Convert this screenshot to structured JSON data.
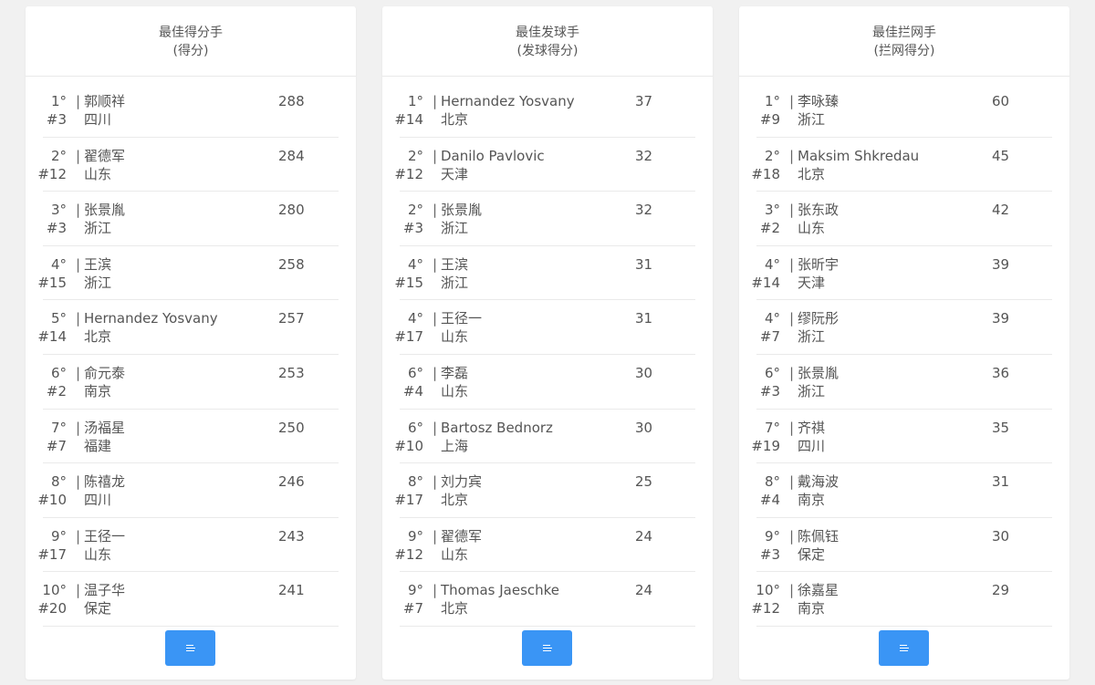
{
  "boards": [
    {
      "title": "最佳得分手",
      "subtitle": "(得分)",
      "button_icon": "list-icon",
      "rows": [
        {
          "rank": "1°",
          "num": "#3",
          "name": "郭顺祥",
          "team": "四川",
          "score": "288"
        },
        {
          "rank": "2°",
          "num": "#12",
          "name": "翟德军",
          "team": "山东",
          "score": "284"
        },
        {
          "rank": "3°",
          "num": "#3",
          "name": "张景胤",
          "team": "浙江",
          "score": "280"
        },
        {
          "rank": "4°",
          "num": "#15",
          "name": "王滨",
          "team": "浙江",
          "score": "258"
        },
        {
          "rank": "5°",
          "num": "#14",
          "name": "Hernandez Yosvany",
          "team": "北京",
          "score": "257"
        },
        {
          "rank": "6°",
          "num": "#2",
          "name": "俞元泰",
          "team": "南京",
          "score": "253"
        },
        {
          "rank": "7°",
          "num": "#7",
          "name": "汤福星",
          "team": "福建",
          "score": "250"
        },
        {
          "rank": "8°",
          "num": "#10",
          "name": "陈禧龙",
          "team": "四川",
          "score": "246"
        },
        {
          "rank": "9°",
          "num": "#17",
          "name": "王径一",
          "team": "山东",
          "score": "243"
        },
        {
          "rank": "10°",
          "num": "#20",
          "name": "温子华",
          "team": "保定",
          "score": "241"
        }
      ]
    },
    {
      "title": "最佳发球手",
      "subtitle": "(发球得分)",
      "button_icon": "list-icon",
      "rows": [
        {
          "rank": "1°",
          "num": "#14",
          "name": "Hernandez Yosvany",
          "team": "北京",
          "score": "37"
        },
        {
          "rank": "2°",
          "num": "#12",
          "name": "Danilo Pavlovic",
          "team": "天津",
          "score": "32"
        },
        {
          "rank": "2°",
          "num": "#3",
          "name": "张景胤",
          "team": "浙江",
          "score": "32"
        },
        {
          "rank": "4°",
          "num": "#15",
          "name": "王滨",
          "team": "浙江",
          "score": "31"
        },
        {
          "rank": "4°",
          "num": "#17",
          "name": "王径一",
          "team": "山东",
          "score": "31"
        },
        {
          "rank": "6°",
          "num": "#4",
          "name": "李磊",
          "team": "山东",
          "score": "30"
        },
        {
          "rank": "6°",
          "num": "#10",
          "name": "Bartosz Bednorz",
          "team": "上海",
          "score": "30"
        },
        {
          "rank": "8°",
          "num": "#17",
          "name": "刘力宾",
          "team": "北京",
          "score": "25"
        },
        {
          "rank": "9°",
          "num": "#12",
          "name": "翟德军",
          "team": "山东",
          "score": "24"
        },
        {
          "rank": "9°",
          "num": "#7",
          "name": "Thomas Jaeschke",
          "team": "北京",
          "score": "24"
        }
      ]
    },
    {
      "title": "最佳拦网手",
      "subtitle": "(拦网得分)",
      "button_icon": "list-icon",
      "rows": [
        {
          "rank": "1°",
          "num": "#9",
          "name": "李咏臻",
          "team": "浙江",
          "score": "60"
        },
        {
          "rank": "2°",
          "num": "#18",
          "name": "Maksim Shkredau",
          "team": "北京",
          "score": "45"
        },
        {
          "rank": "3°",
          "num": "#2",
          "name": "张东政",
          "team": "山东",
          "score": "42"
        },
        {
          "rank": "4°",
          "num": "#14",
          "name": "张昕宇",
          "team": "天津",
          "score": "39"
        },
        {
          "rank": "4°",
          "num": "#7",
          "name": "缪阮彤",
          "team": "浙江",
          "score": "39"
        },
        {
          "rank": "6°",
          "num": "#3",
          "name": "张景胤",
          "team": "浙江",
          "score": "36"
        },
        {
          "rank": "7°",
          "num": "#19",
          "name": "齐祺",
          "team": "四川",
          "score": "35"
        },
        {
          "rank": "8°",
          "num": "#4",
          "name": "戴海波",
          "team": "南京",
          "score": "31"
        },
        {
          "rank": "9°",
          "num": "#3",
          "name": "陈佩钰",
          "team": "保定",
          "score": "30"
        },
        {
          "rank": "10°",
          "num": "#12",
          "name": "徐嘉星",
          "team": "南京",
          "score": "29"
        }
      ]
    }
  ],
  "colors": {
    "background": "#f1f1f1",
    "card": "#ffffff",
    "button": "#3a95f5",
    "text": "#555555",
    "divider": "#eaeaea"
  }
}
